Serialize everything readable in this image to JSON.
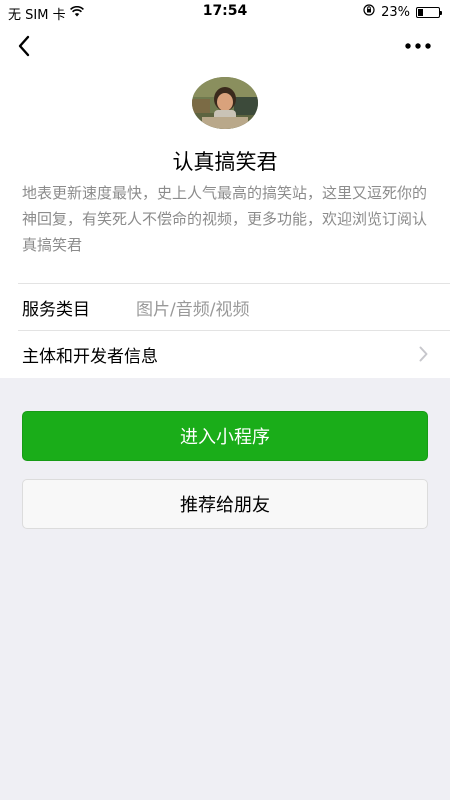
{
  "status_bar": {
    "carrier": "无 SIM 卡",
    "wifi_icon": "wifi-icon",
    "time": "17:54",
    "orientation_lock_icon": "orientation-lock-icon",
    "battery_percent": "23%",
    "battery_level": 0.23
  },
  "nav": {
    "back_icon": "chevron-left-icon",
    "more_icon": "more-dots-icon"
  },
  "profile": {
    "name": "认真搞笑君",
    "description": "地表更新速度最快，史上人气最高的搞笑站，这里又逗死你的神回复，有笑死人不偿命的视频，更多功能，欢迎浏览订阅认真搞笑君"
  },
  "info": {
    "service_label": "服务类目",
    "service_value": "图片/音频/视频",
    "developer_label": "主体和开发者信息"
  },
  "actions": {
    "enter_label": "进入小程序",
    "share_label": "推荐给朋友"
  },
  "colors": {
    "primary": "#1aad19",
    "background": "#efeff4"
  }
}
